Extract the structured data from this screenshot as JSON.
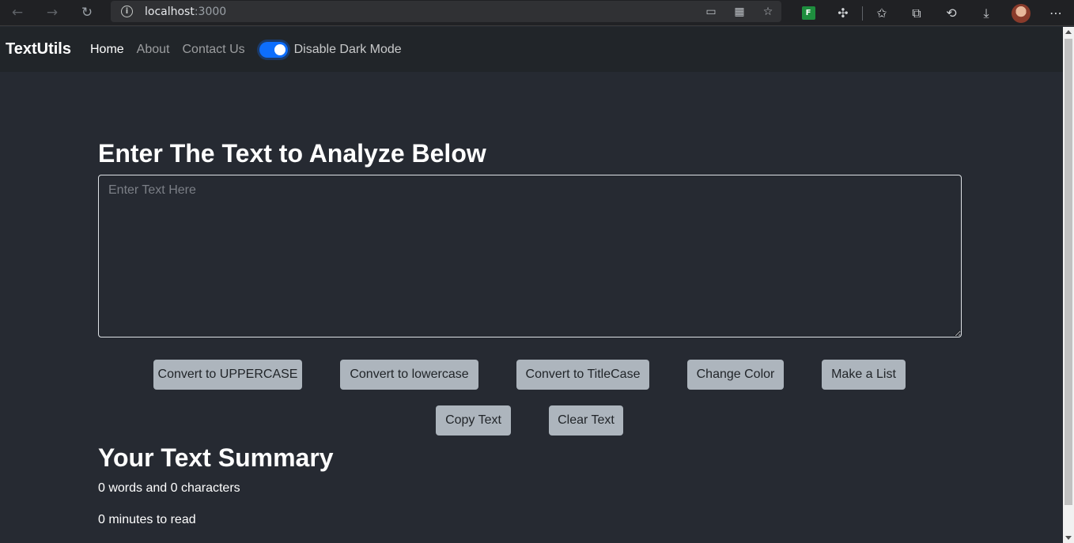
{
  "browser": {
    "url_host": "localhost",
    "url_port": ":3000"
  },
  "navbar": {
    "brand": "TextUtils",
    "links": [
      "Home",
      "About",
      "Contact Us"
    ],
    "toggle_label": "Disable Dark Mode",
    "toggle_on": true
  },
  "main": {
    "heading": "Enter The Text to Analyze Below",
    "textarea_placeholder": "Enter Text Here",
    "textarea_value": "",
    "buttons": [
      "Convert to UPPERCASE",
      "Convert to lowercase",
      "Convert to TitleCase",
      "Change Color",
      "Make a List",
      "Copy Text",
      "Clear Text"
    ]
  },
  "summary": {
    "title": "Your Text Summary",
    "counts": "0 words and 0 characters",
    "read_time": "0 minutes to read"
  },
  "colors": {
    "background": "#262a32",
    "navbar": "#212529",
    "button": "#adb5bd",
    "switch": "#0d6efd"
  }
}
